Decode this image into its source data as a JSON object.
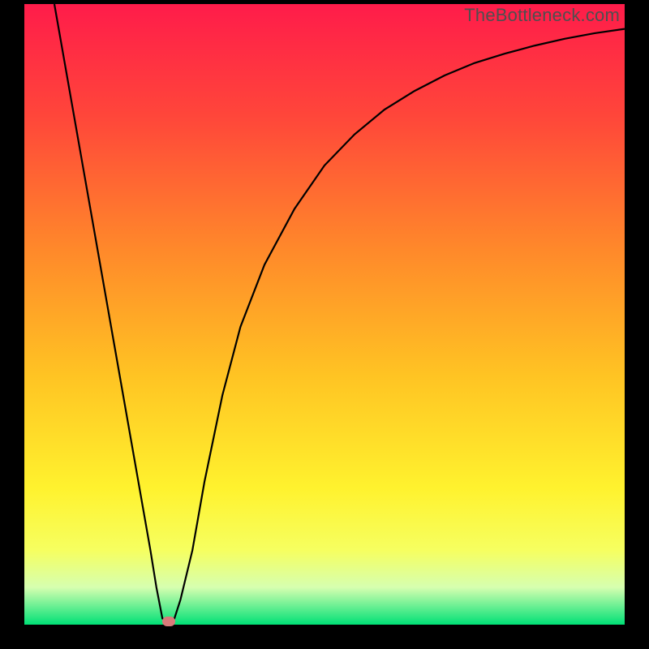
{
  "watermark": "TheBottleneck.com",
  "chart_data": {
    "type": "line",
    "title": "",
    "xlabel": "",
    "ylabel": "",
    "xlim": [
      0,
      100
    ],
    "ylim": [
      0,
      100
    ],
    "grid": false,
    "legend": false,
    "background_gradient": {
      "stops": [
        {
          "pos": 0.0,
          "color": "#ff1c4a"
        },
        {
          "pos": 0.18,
          "color": "#ff463a"
        },
        {
          "pos": 0.4,
          "color": "#ff8a2a"
        },
        {
          "pos": 0.6,
          "color": "#ffc423"
        },
        {
          "pos": 0.78,
          "color": "#fff22e"
        },
        {
          "pos": 0.88,
          "color": "#f6ff60"
        },
        {
          "pos": 0.94,
          "color": "#d6ffb0"
        },
        {
          "pos": 1.0,
          "color": "#00e076"
        }
      ]
    },
    "series": [
      {
        "name": "curve",
        "color": "#000000",
        "x": [
          5,
          7,
          9,
          11,
          13,
          15,
          17,
          19,
          21,
          22,
          23,
          24,
          25,
          26,
          28,
          30,
          33,
          36,
          40,
          45,
          50,
          55,
          60,
          65,
          70,
          75,
          80,
          85,
          90,
          95,
          100
        ],
        "y": [
          100,
          89,
          78,
          67,
          56,
          45,
          34,
          23,
          12,
          6,
          1,
          0.5,
          1,
          4,
          12,
          23,
          37,
          48,
          58,
          67,
          74,
          79,
          83,
          86,
          88.5,
          90.5,
          92,
          93.3,
          94.4,
          95.3,
          96
        ]
      }
    ],
    "marker": {
      "x": 24,
      "y": 0.5,
      "color": "#d97a7a"
    }
  }
}
